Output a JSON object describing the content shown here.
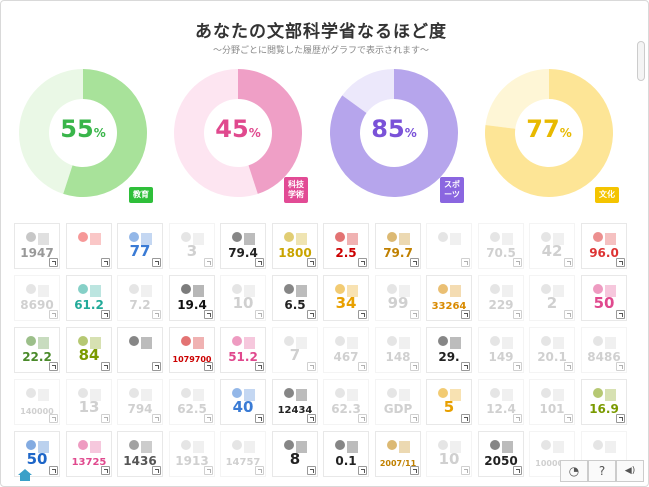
{
  "header": {
    "title": "あなたの文部科学省なるほど度",
    "subtitle": "～分野ごとに閲覧した履歴がグラフで表示されます～"
  },
  "chart_data": {
    "type": "pie",
    "charts": [
      {
        "label": "教育",
        "value": 55,
        "color": "#a8e29a",
        "light": "#eaf8e6",
        "text": "#39b54a",
        "tag": "#2fbf3a"
      },
      {
        "label": "科技学術",
        "value": 45,
        "color": "#ef9fc6",
        "light": "#fde5f1",
        "text": "#e0498e",
        "tag": "#e24b95"
      },
      {
        "label": "スポーツ",
        "value": 85,
        "color": "#b6a5ec",
        "light": "#ece8fb",
        "text": "#7a52d8",
        "tag": "#8a66e0"
      },
      {
        "label": "文化",
        "value": 77,
        "color": "#fde596",
        "light": "#fef6d6",
        "text": "#e8b900",
        "tag": "#f4c400"
      }
    ]
  },
  "charts_display": {
    "c0": {
      "value": "55",
      "unit": "%",
      "tag1": "教育",
      "tag2": ""
    },
    "c1": {
      "value": "45",
      "unit": "%",
      "tag1": "科技",
      "tag2": "学術"
    },
    "c2": {
      "value": "85",
      "unit": "%",
      "tag1": "スポ",
      "tag2": "ーツ"
    },
    "c3": {
      "value": "77",
      "unit": "%",
      "tag1": "文化",
      "tag2": ""
    }
  },
  "tiles": [
    {
      "n": "1947",
      "c": "#999",
      "g": false
    },
    {
      "n": "",
      "c": "#e44",
      "g": false
    },
    {
      "n": "77",
      "c": "#3a7bd5",
      "g": false
    },
    {
      "n": "3",
      "c": "#999",
      "g": true
    },
    {
      "n": "79.4",
      "c": "#222",
      "g": false
    },
    {
      "n": "1800",
      "c": "#c9a400",
      "g": false
    },
    {
      "n": "2.5",
      "c": "#c00",
      "g": false
    },
    {
      "n": "79.7",
      "c": "#c08000",
      "g": false
    },
    {
      "n": "",
      "c": "#999",
      "g": true
    },
    {
      "n": "70.5",
      "c": "#999",
      "g": true
    },
    {
      "n": "42",
      "c": "#999",
      "g": true
    },
    {
      "n": "96.0",
      "c": "#d33",
      "g": false
    },
    {
      "n": "8690",
      "c": "#999",
      "g": true
    },
    {
      "n": "61.2",
      "c": "#2a9",
      "g": false
    },
    {
      "n": "7.2",
      "c": "#999",
      "g": true
    },
    {
      "n": "19.4",
      "c": "#111",
      "g": false
    },
    {
      "n": "10",
      "c": "#999",
      "g": true
    },
    {
      "n": "6.5",
      "c": "#222",
      "g": false
    },
    {
      "n": "34",
      "c": "#e8a000",
      "g": false
    },
    {
      "n": "99",
      "c": "#999",
      "g": true
    },
    {
      "n": "33264",
      "c": "#d98a00",
      "g": false
    },
    {
      "n": "229",
      "c": "#999",
      "g": true
    },
    {
      "n": "2",
      "c": "#999",
      "g": true
    },
    {
      "n": "50",
      "c": "#e0498e",
      "g": false
    },
    {
      "n": "22.2",
      "c": "#4a8a2a",
      "g": false
    },
    {
      "n": "84",
      "c": "#7a9a00",
      "g": false
    },
    {
      "n": "",
      "c": "#222",
      "g": false
    },
    {
      "n": "1079700",
      "c": "#c00",
      "g": false
    },
    {
      "n": "51.2",
      "c": "#e0498e",
      "g": false
    },
    {
      "n": "7",
      "c": "#999",
      "g": true
    },
    {
      "n": "467",
      "c": "#999",
      "g": true
    },
    {
      "n": "148",
      "c": "#999",
      "g": true
    },
    {
      "n": "29.",
      "c": "#222",
      "g": false
    },
    {
      "n": "149",
      "c": "#999",
      "g": true
    },
    {
      "n": "20.1",
      "c": "#999",
      "g": true
    },
    {
      "n": "8486",
      "c": "#999",
      "g": true
    },
    {
      "n": "140000",
      "c": "#999",
      "g": true
    },
    {
      "n": "13",
      "c": "#999",
      "g": true
    },
    {
      "n": "794",
      "c": "#999",
      "g": true
    },
    {
      "n": "62.5",
      "c": "#999",
      "g": true
    },
    {
      "n": "40",
      "c": "#3a7bd5",
      "g": false
    },
    {
      "n": "12434",
      "c": "#222",
      "g": false
    },
    {
      "n": "62.3",
      "c": "#999",
      "g": true
    },
    {
      "n": "GDP",
      "c": "#999",
      "g": true
    },
    {
      "n": "5",
      "c": "#e8a000",
      "g": false
    },
    {
      "n": "12.4",
      "c": "#999",
      "g": true
    },
    {
      "n": "101",
      "c": "#999",
      "g": true
    },
    {
      "n": "16.9",
      "c": "#7a9a00",
      "g": false
    },
    {
      "n": "50",
      "c": "#1e66c8",
      "g": false
    },
    {
      "n": "13725",
      "c": "#e0498e",
      "g": false
    },
    {
      "n": "1436",
      "c": "#555",
      "g": false
    },
    {
      "n": "1913",
      "c": "#999",
      "g": true
    },
    {
      "n": "14757",
      "c": "#999",
      "g": true
    },
    {
      "n": "8",
      "c": "#222",
      "g": false
    },
    {
      "n": "0.1",
      "c": "#222",
      "g": false
    },
    {
      "n": "2007/11",
      "c": "#c08000",
      "g": false
    },
    {
      "n": "10",
      "c": "#999",
      "g": true
    },
    {
      "n": "2050",
      "c": "#222",
      "g": false
    },
    {
      "n": "100000",
      "c": "#999",
      "g": true
    },
    {
      "n": "",
      "c": "#999",
      "g": true
    }
  ],
  "controls": {
    "chart_icon": "◔",
    "help_icon": "?",
    "sound_icon": "◀)"
  }
}
